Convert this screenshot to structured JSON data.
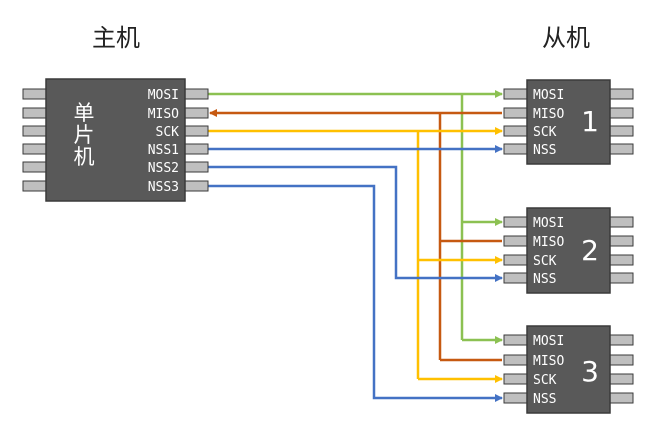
{
  "titles": {
    "master": "主机",
    "slaves": "从机"
  },
  "master_chip": {
    "label_chars": [
      "单",
      "片",
      "机"
    ],
    "pins": [
      "MOSI",
      "MISO",
      "SCK",
      "NSS1",
      "NSS2",
      "NSS3"
    ]
  },
  "slave_chips": [
    {
      "number": "1",
      "pins": [
        "MOSI",
        "MISO",
        "SCK",
        "NSS"
      ]
    },
    {
      "number": "2",
      "pins": [
        "MOSI",
        "MISO",
        "SCK",
        "NSS"
      ]
    },
    {
      "number": "3",
      "pins": [
        "MOSI",
        "MISO",
        "SCK",
        "NSS"
      ]
    }
  ],
  "colors": {
    "chip": "#595959",
    "pin": "#bfbfbf",
    "mosi": "#8cc152",
    "miso": "#c65911",
    "sck": "#ffc000",
    "nss": "#4472c4"
  }
}
